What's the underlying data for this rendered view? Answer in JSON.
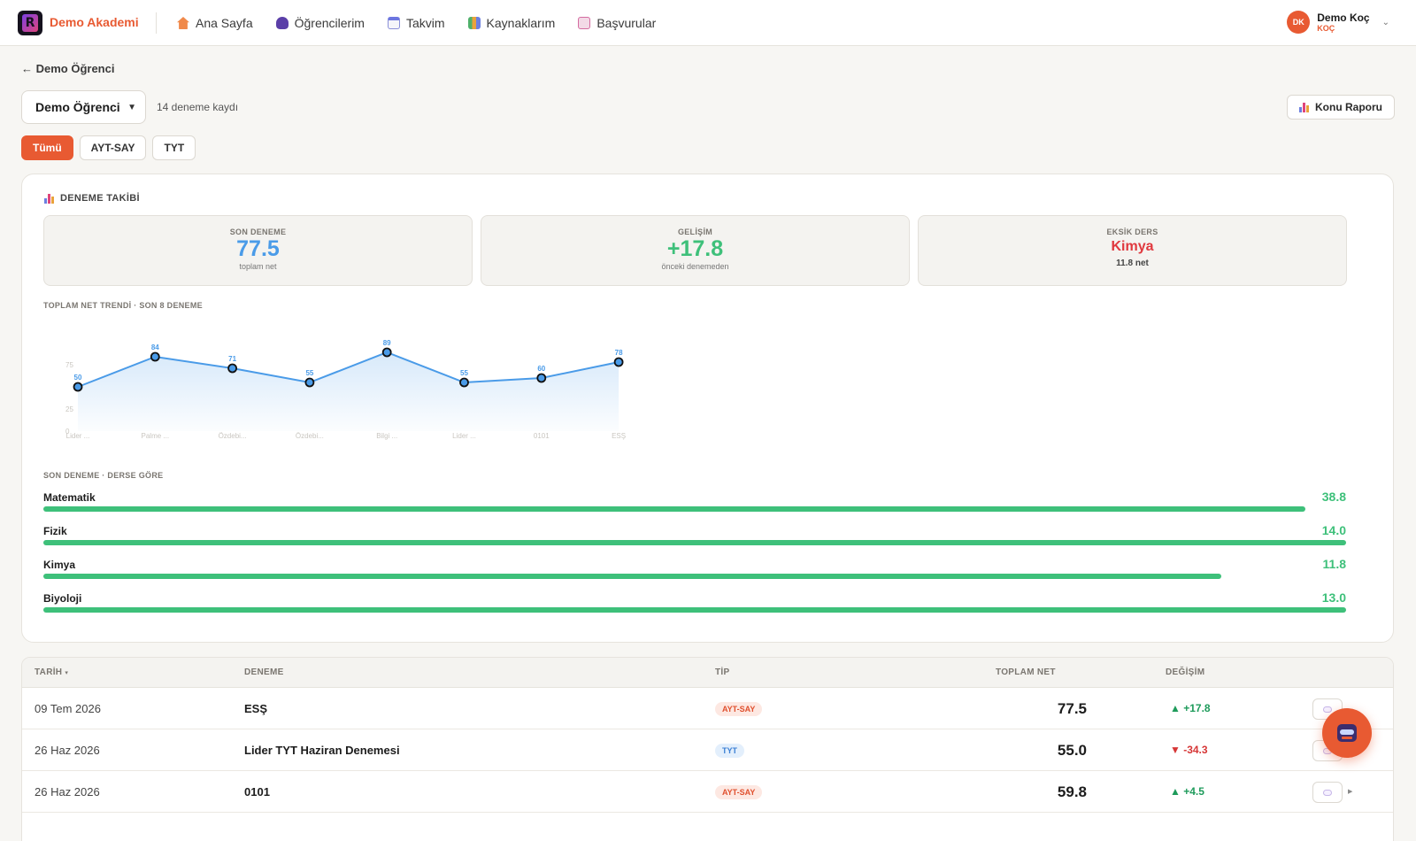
{
  "nav": {
    "brand": "Demo Akademi",
    "links": [
      {
        "label": "Ana Sayfa",
        "icon": "home-icon"
      },
      {
        "label": "Öğrencilerim",
        "icon": "student-icon"
      },
      {
        "label": "Takvim",
        "icon": "calendar-icon"
      },
      {
        "label": "Kaynaklarım",
        "icon": "books-icon"
      },
      {
        "label": "Başvurular",
        "icon": "inbox-icon"
      }
    ],
    "user": {
      "initials": "DK",
      "name": "Demo Koç",
      "role": "KOÇ"
    }
  },
  "header": {
    "back_label": "← Demo Öğrenci",
    "student_select": "Demo Öğrenci",
    "record_count": "14 deneme kaydı",
    "report_button": "Konu Raporu"
  },
  "tabs": [
    {
      "label": "Tümü",
      "active": true
    },
    {
      "label": "AYT-SAY",
      "active": false
    },
    {
      "label": "TYT",
      "active": false
    }
  ],
  "tracking": {
    "title": "DENEME TAKİBİ",
    "stats": {
      "last": {
        "label": "SON DENEME",
        "value": "77.5",
        "sub": "toplam net"
      },
      "progress": {
        "label": "GELİŞİM",
        "value": "+17.8",
        "sub": "önceki denemeden"
      },
      "weak": {
        "label": "EKSİK DERS",
        "value": "Kimya",
        "sub": "11.8 net"
      }
    },
    "trend_label": "TOPLAM NET TRENDİ · SON 8 DENEME",
    "subjects_label": "SON DENEME · DERSE GÖRE",
    "subjects": [
      {
        "name": "Matematik",
        "value": "38.8",
        "fill": 0.969
      },
      {
        "name": "Fizik",
        "value": "14.0",
        "fill": 1.0
      },
      {
        "name": "Kimya",
        "value": "11.8",
        "fill": 0.904
      },
      {
        "name": "Biyoloji",
        "value": "13.0",
        "fill": 1.0
      }
    ]
  },
  "chart_data": {
    "type": "line",
    "title": "TOPLAM NET TRENDİ · SON 8 DENEME",
    "categories": [
      "Lider ...",
      "Palme ...",
      "Özdebi...",
      "Özdebi...",
      "Bilgi ...",
      "Lider ...",
      "0101",
      "ESŞ"
    ],
    "values": [
      50,
      84,
      71,
      55,
      89,
      55,
      60,
      78
    ],
    "y_ticks": [
      "75",
      "25",
      "0"
    ],
    "ylim": [
      0,
      100
    ],
    "color": "#4a9be8"
  },
  "table": {
    "headers": {
      "date": "TARİH",
      "name": "DENEME",
      "type": "TİP",
      "net": "TOPLAM NET",
      "change": "DEĞİŞİM"
    },
    "rows": [
      {
        "date": "09 Tem 2026",
        "name": "ESŞ",
        "type": "AYT-SAY",
        "net": "77.5",
        "change": "▲ +17.8",
        "dir": "up"
      },
      {
        "date": "26 Haz 2026",
        "name": "Lider TYT Haziran Denemesi",
        "type": "TYT",
        "net": "55.0",
        "change": "▼ -34.3",
        "dir": "down"
      },
      {
        "date": "26 Haz 2026",
        "name": "0101",
        "type": "AYT-SAY",
        "net": "59.8",
        "change": "▲ +4.5",
        "dir": "up"
      }
    ]
  },
  "colors": {
    "accent": "#e85a32",
    "blue": "#4a9be8",
    "green": "#3ec07a",
    "red": "#e0383e"
  }
}
